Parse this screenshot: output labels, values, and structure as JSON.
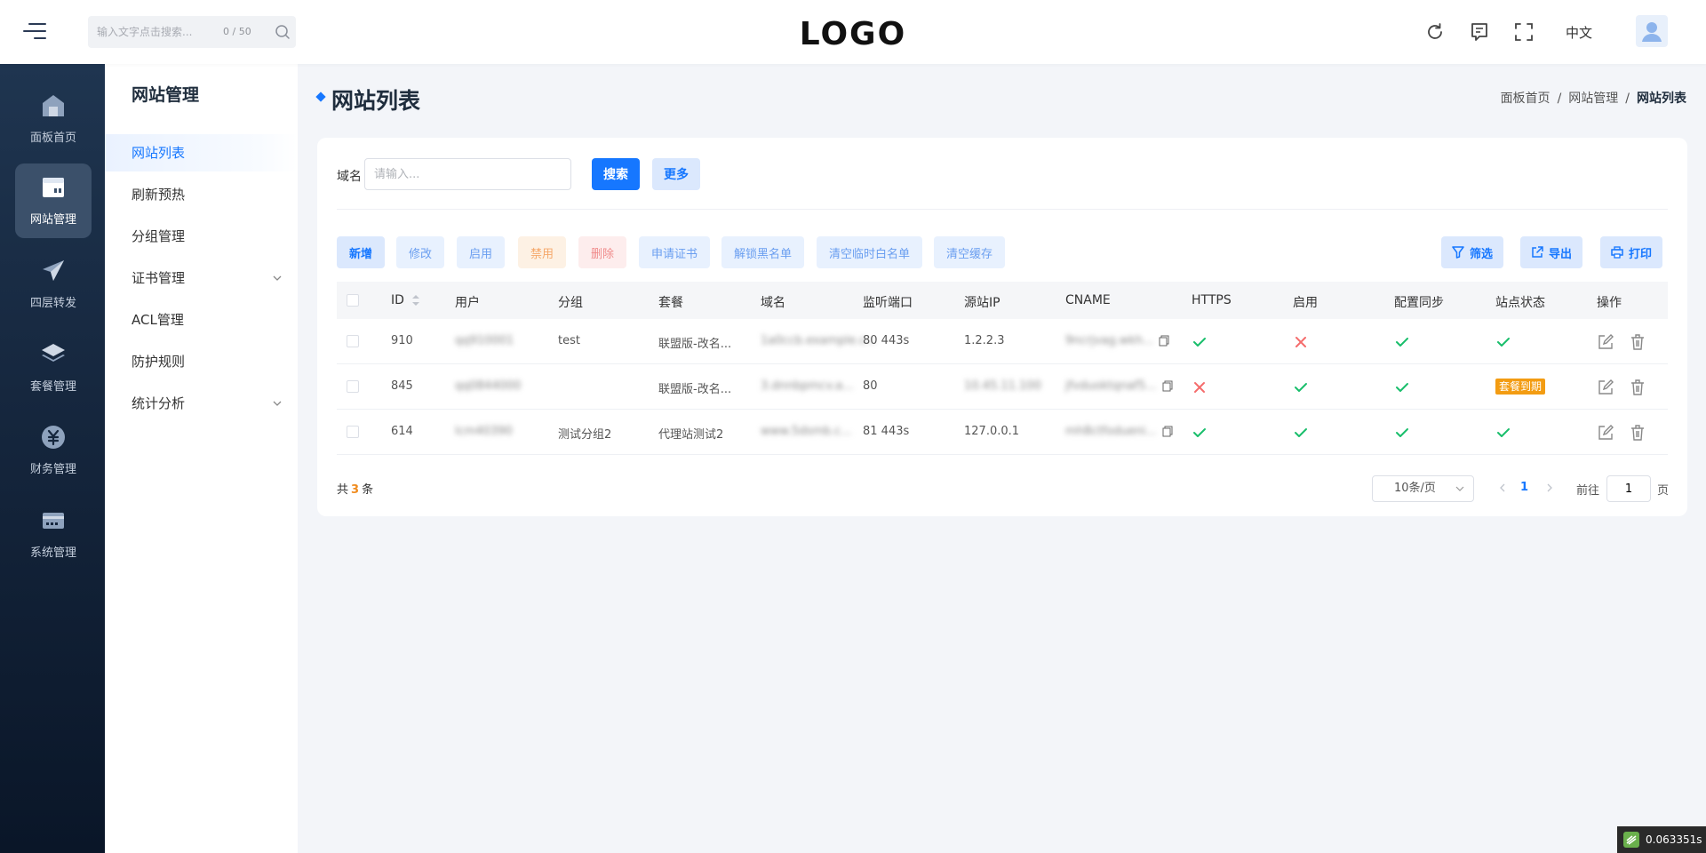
{
  "header": {
    "search_placeholder": "输入文字点击搜索...",
    "search_count": "0 / 50",
    "logo_text": "LOGO",
    "lang": "中文"
  },
  "leftbar": {
    "items": [
      {
        "label": "面板首页",
        "icon": "home-icon"
      },
      {
        "label": "网站管理",
        "icon": "website-icon",
        "active": true
      },
      {
        "label": "四层转发",
        "icon": "paper-plane-icon"
      },
      {
        "label": "套餐管理",
        "icon": "layers-icon"
      },
      {
        "label": "财务管理",
        "icon": "yen-icon"
      },
      {
        "label": "系统管理",
        "icon": "card-icon"
      }
    ]
  },
  "submenu": {
    "title": "网站管理",
    "items": [
      {
        "label": "网站列表",
        "active": true
      },
      {
        "label": "刷新预热"
      },
      {
        "label": "分组管理"
      },
      {
        "label": "证书管理",
        "expandable": true
      },
      {
        "label": "ACL管理"
      },
      {
        "label": "防护规则"
      },
      {
        "label": "统计分析",
        "expandable": true
      }
    ]
  },
  "page": {
    "title": "网站列表",
    "breadcrumb": [
      "面板首页",
      "网站管理",
      "网站列表"
    ]
  },
  "filter": {
    "label": "域名",
    "placeholder": "请输入...",
    "search_btn": "搜索",
    "more_btn": "更多"
  },
  "toolbar": {
    "buttons": [
      "新增",
      "修改",
      "启用",
      "禁用",
      "删除",
      "申请证书",
      "解锁黑名单",
      "清空临时白名单",
      "清空缓存"
    ],
    "right_buttons": [
      "筛选",
      "导出",
      "打印"
    ]
  },
  "table": {
    "columns": [
      "ID",
      "用户",
      "分组",
      "套餐",
      "域名",
      "监听端口",
      "源站IP",
      "CNAME",
      "HTTPS",
      "启用",
      "配置同步",
      "站点状态",
      "操作"
    ],
    "rows": [
      {
        "id": "910",
        "user": "qq910001",
        "group": "test",
        "plan": "联盟版-改名...",
        "domain": "1a0ccb.example.c...",
        "port": "80 443s",
        "origin": "1.2.2.3",
        "cname": "9ncrjvag.wkh...",
        "https": true,
        "enabled": false,
        "sync": true,
        "status_ok": true,
        "status_badge": ""
      },
      {
        "id": "845",
        "user": "qq0844000",
        "group": "",
        "plan": "联盟版-改名...",
        "domain": "3.dnnbpmcv.a...",
        "port": "80",
        "origin": "10.45.11.100",
        "cname": "jfvduoktqnaf5...",
        "https": false,
        "enabled": true,
        "sync": true,
        "status_ok": false,
        "status_badge": "套餐到期"
      },
      {
        "id": "614",
        "user": "lcm40390",
        "group": "测试分组2",
        "plan": "代理站测试2",
        "domain": "www.5dsmb.c...",
        "port": "81 443s",
        "origin": "127.0.0.1",
        "cname": "mh8ctfodueni...",
        "https": true,
        "enabled": true,
        "sync": true,
        "status_ok": true,
        "status_badge": ""
      }
    ]
  },
  "pagination": {
    "total_prefix": "共",
    "total": "3",
    "total_suffix": "条",
    "page_size": "10条/页",
    "current_page": "1",
    "goto_label": "前往",
    "goto_value": "1",
    "goto_suffix": "页"
  },
  "timer": "0.063351s",
  "colors": {
    "primary": "#1677ff",
    "sidebar_dark": "#15263d",
    "success": "#19be6b",
    "danger": "#f56c6c",
    "warning": "#f39c12"
  }
}
